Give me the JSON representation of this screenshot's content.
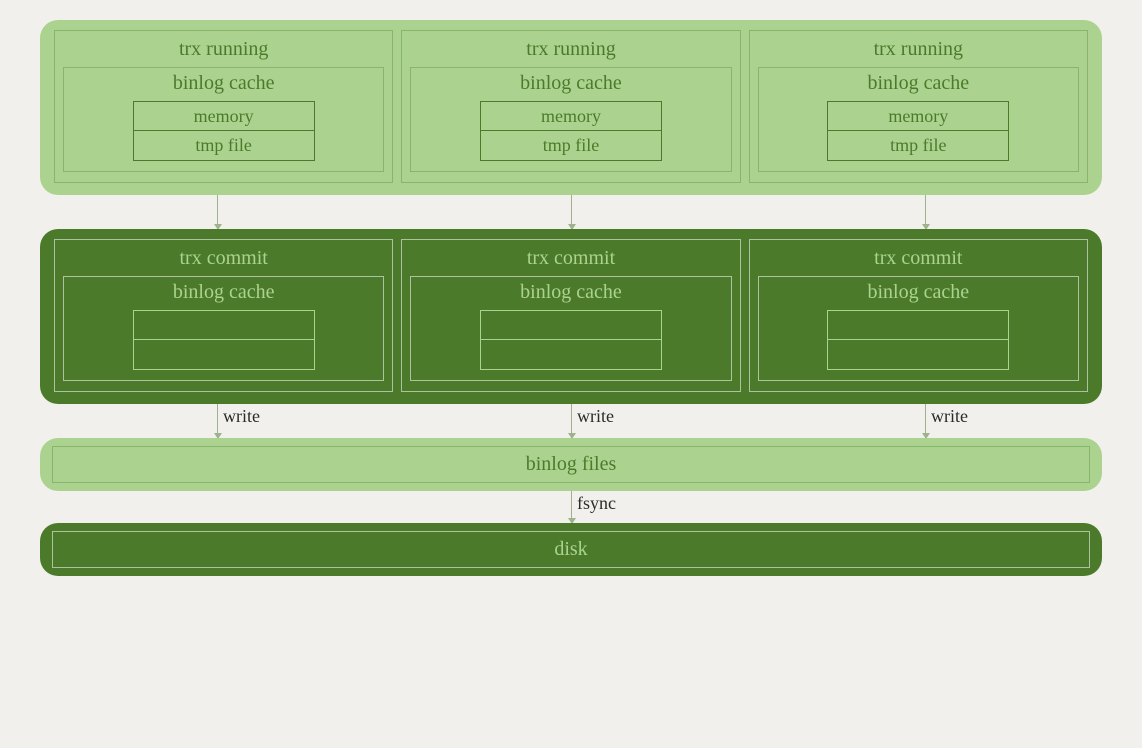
{
  "stage1": {
    "columns": [
      {
        "title": "trx running",
        "inner_title": "binlog cache",
        "cells": [
          "memory",
          "tmp file"
        ]
      },
      {
        "title": "trx running",
        "inner_title": "binlog cache",
        "cells": [
          "memory",
          "tmp file"
        ]
      },
      {
        "title": "trx running",
        "inner_title": "binlog cache",
        "cells": [
          "memory",
          "tmp file"
        ]
      }
    ]
  },
  "arrows1": [
    "",
    "",
    ""
  ],
  "stage2": {
    "columns": [
      {
        "title": "trx commit",
        "inner_title": "binlog cache",
        "cells": [
          "",
          ""
        ]
      },
      {
        "title": "trx commit",
        "inner_title": "binlog cache",
        "cells": [
          "",
          ""
        ]
      },
      {
        "title": "trx commit",
        "inner_title": "binlog cache",
        "cells": [
          "",
          ""
        ]
      }
    ]
  },
  "arrows2": [
    "write",
    "write",
    "write"
  ],
  "stage3": {
    "label": "binlog files"
  },
  "arrow3": "fsync",
  "stage4": {
    "label": "disk"
  }
}
